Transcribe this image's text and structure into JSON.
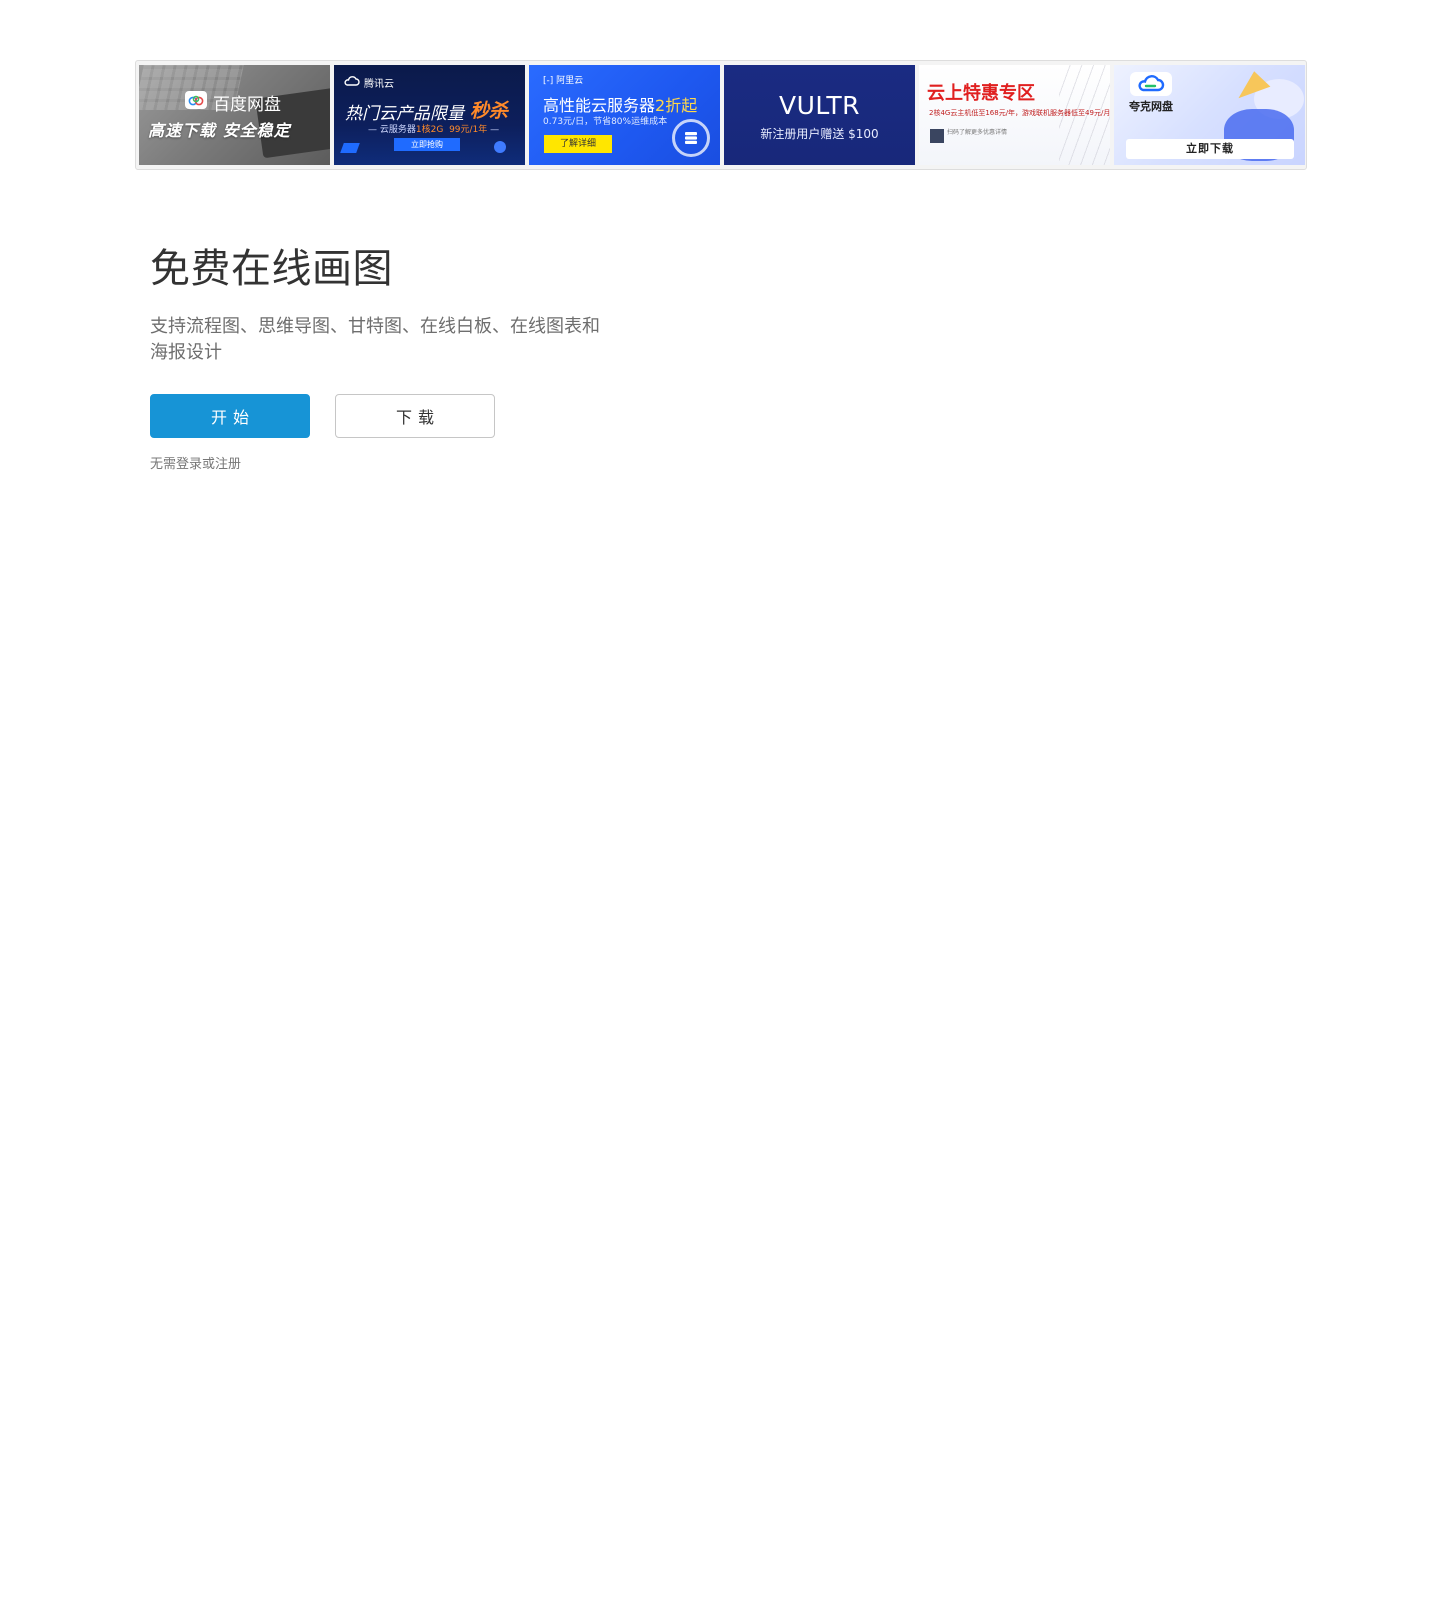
{
  "ads": {
    "baidu": {
      "brand": "百度网盘",
      "slogan": "高速下载   安全稳定"
    },
    "tencent": {
      "logo": "腾讯云",
      "headline": "热门云产品限量",
      "headline_accent": "秒杀",
      "sub_prefix": "云服务器",
      "sub_spec": "1核2G",
      "sub_price": "99元/1年",
      "cta": "立即抢购"
    },
    "aliyun": {
      "logo": "阿里云",
      "headline_prefix": "高性能云服务器",
      "headline_accent": "2折起",
      "sub": "0.73元/日，节省80%运维成本",
      "cta": "了解详细"
    },
    "vultr": {
      "brand": "VULTR",
      "sub": "新注册用户赠送 $100"
    },
    "zone": {
      "title": "云上特惠专区",
      "sub": "2核4G云主机低至168元/年，游戏联机服务器低至49元/月",
      "qr_text": "扫码了解更多优惠详情"
    },
    "quark": {
      "brand": "夸克网盘",
      "cta": "立即下载"
    }
  },
  "hero": {
    "title": "免费在线画图",
    "description": "支持流程图、思维导图、甘特图、在线白板、在线图表和海报设计",
    "start_label": "开始",
    "download_label": "下载",
    "note": "无需登录或注册"
  },
  "colors": {
    "primary": "#1794d6",
    "title": "#333333",
    "muted": "#6e6e6e"
  },
  "icons": {
    "baidu_logo": "baidu-cloud-icon",
    "tencent_logo": "tencent-cloud-icon",
    "aliyun_logo": "aliyun-icon",
    "aliyun_server": "server-icon",
    "quark_logo": "quark-cloud-icon"
  }
}
